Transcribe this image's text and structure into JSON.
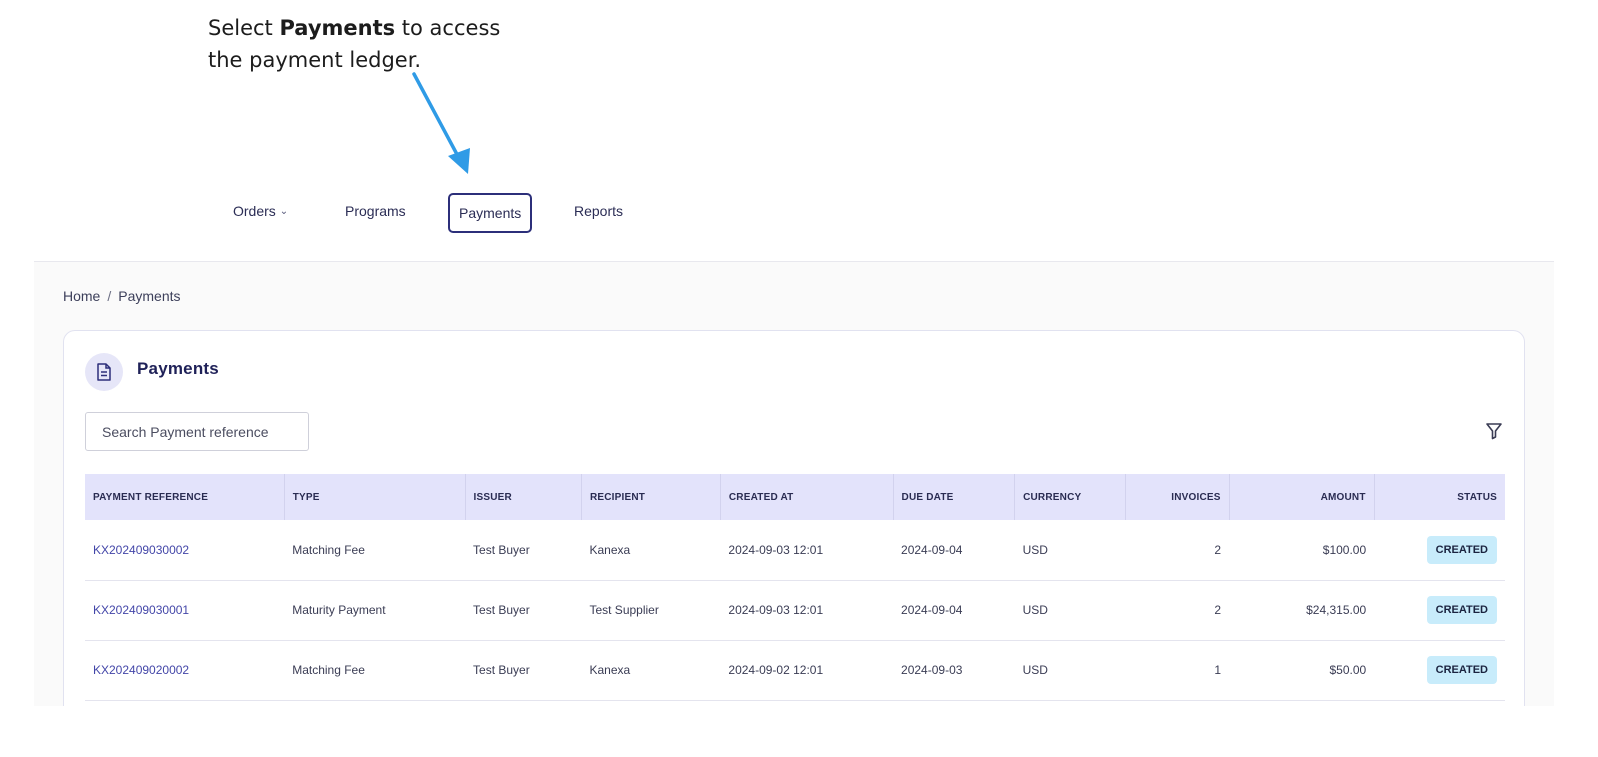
{
  "callout": {
    "prefix": "Select ",
    "bold": "Payments",
    "suffix": " to access",
    "line2": "the payment ledger."
  },
  "nav": {
    "items": [
      {
        "label": "Orders",
        "has_dropdown": true
      },
      {
        "label": "Programs"
      },
      {
        "label": "Payments",
        "active": true
      },
      {
        "label": "Reports"
      }
    ]
  },
  "breadcrumb": {
    "home": "Home",
    "separator": "/",
    "current": "Payments"
  },
  "page": {
    "title": "Payments",
    "icon": "document-icon"
  },
  "search": {
    "placeholder": "Search Payment reference"
  },
  "table": {
    "headers": [
      "PAYMENT REFERENCE",
      "TYPE",
      "ISSUER",
      "RECIPIENT",
      "CREATED AT",
      "DUE DATE",
      "CURRENCY",
      "INVOICES",
      "AMOUNT",
      "STATUS"
    ],
    "rows": [
      {
        "reference": "KX202409030002",
        "type": "Matching Fee",
        "issuer": "Test Buyer",
        "recipient": "Kanexa",
        "created_at": "2024-09-03 12:01",
        "due_date": "2024-09-04",
        "currency": "USD",
        "invoices": "2",
        "amount": "$100.00",
        "status": "CREATED"
      },
      {
        "reference": "KX202409030001",
        "type": "Maturity Payment",
        "issuer": "Test Buyer",
        "recipient": "Test Supplier",
        "created_at": "2024-09-03 12:01",
        "due_date": "2024-09-04",
        "currency": "USD",
        "invoices": "2",
        "amount": "$24,315.00",
        "status": "CREATED"
      },
      {
        "reference": "KX202409020002",
        "type": "Matching Fee",
        "issuer": "Test Buyer",
        "recipient": "Kanexa",
        "created_at": "2024-09-02 12:01",
        "due_date": "2024-09-03",
        "currency": "USD",
        "invoices": "1",
        "amount": "$50.00",
        "status": "CREATED"
      }
    ]
  },
  "colors": {
    "accent": "#2c2f7a",
    "header_bg": "#e3e3fb",
    "link": "#4346a8",
    "badge_bg": "#c8ecfb",
    "arrow": "#2f9be6"
  }
}
